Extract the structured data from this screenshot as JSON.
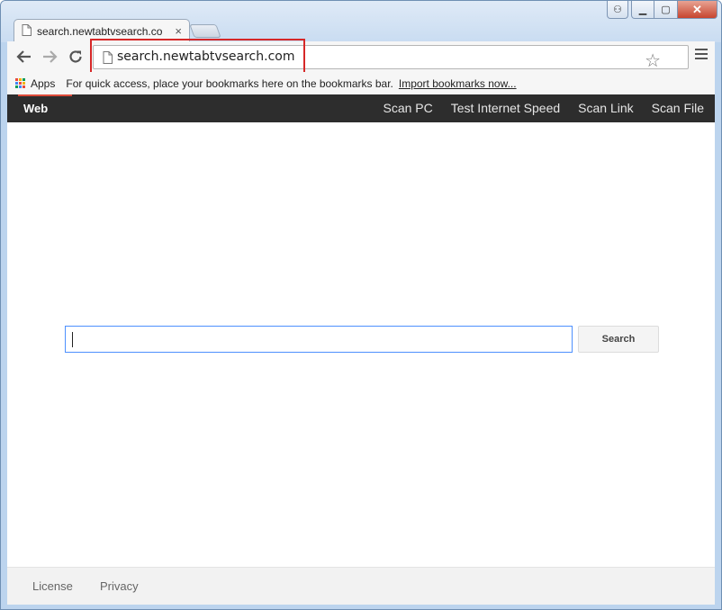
{
  "tab": {
    "title": "search.newtabtvsearch.co",
    "close": "×"
  },
  "window": {
    "min": "▁",
    "max": "▢",
    "close": "✕",
    "user": "⚇"
  },
  "omnibox": {
    "url": "search.newtabtvsearch.com"
  },
  "bookmarks": {
    "apps_label": "Apps",
    "info": "For quick access, place your bookmarks here on the bookmarks bar.",
    "import_link": "Import bookmarks now..."
  },
  "topnav": {
    "web": "Web",
    "items": [
      "Scan PC",
      "Test Internet Speed",
      "Scan Link",
      "Scan File"
    ]
  },
  "search": {
    "value": "",
    "button": "Search"
  },
  "footer": {
    "license": "License",
    "privacy": "Privacy"
  },
  "colors": {
    "accent_red": "#dd4b39",
    "nav_bg": "#2d2d2d",
    "focus_blue": "#4d90fe",
    "highlight": "#d62828"
  },
  "icons": {
    "back": "←",
    "forward": "→",
    "reload": "↻",
    "star": "☆"
  }
}
